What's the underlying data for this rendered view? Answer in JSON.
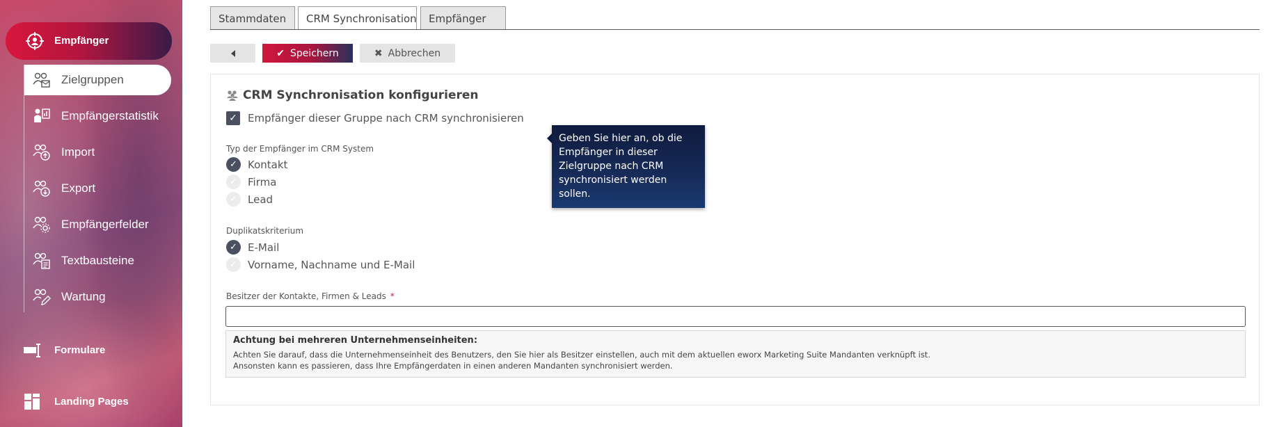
{
  "sidebar": {
    "main_item": {
      "label": "Empfänger",
      "icon": "recipient-target-icon"
    },
    "sub_items": [
      {
        "label": "Zielgruppen",
        "icon": "target-group-icon",
        "active": true
      },
      {
        "label": "Empfängerstatistik",
        "icon": "statistics-icon",
        "active": false
      },
      {
        "label": "Import",
        "icon": "import-icon",
        "active": false
      },
      {
        "label": "Export",
        "icon": "export-icon",
        "active": false
      },
      {
        "label": "Empfängerfelder",
        "icon": "fields-icon",
        "active": false
      },
      {
        "label": "Textbausteine",
        "icon": "text-blocks-icon",
        "active": false
      },
      {
        "label": "Wartung",
        "icon": "maintenance-icon",
        "active": false
      }
    ],
    "sections": [
      {
        "label": "Formulare",
        "icon": "forms-icon"
      },
      {
        "label": "Landing Pages",
        "icon": "landing-pages-icon"
      }
    ]
  },
  "tabs": [
    {
      "label": "Stammdaten",
      "active": false
    },
    {
      "label": "CRM Synchronisation",
      "active": true
    },
    {
      "label": "Empfänger",
      "active": false
    }
  ],
  "toolbar": {
    "back_icon": "caret-left-icon",
    "save_label": "Speichern",
    "cancel_label": "Abbrechen"
  },
  "panel": {
    "title": "CRM Synchronisation konfigurieren",
    "sync_checkbox_label": "Empfänger dieser Gruppe nach CRM synchronisieren",
    "sync_checked": true,
    "type_label": "Typ der Empfänger im CRM System",
    "type_options": [
      {
        "label": "Kontakt",
        "selected": true
      },
      {
        "label": "Firma",
        "selected": false
      },
      {
        "label": "Lead",
        "selected": false
      }
    ],
    "duplicate_label": "Duplikatskriterium",
    "duplicate_options": [
      {
        "label": "E-Mail",
        "selected": true
      },
      {
        "label": "Vorname, Nachname und E-Mail",
        "selected": false
      }
    ],
    "owner_label": "Besitzer der Kontakte, Firmen & Leads",
    "owner_required": "*",
    "owner_value": "",
    "note_title": "Achtung bei mehreren Unternehmenseinheiten:",
    "note_line1": "Achten Sie darauf, dass die Unternehmenseinheit des Benutzers, den Sie hier als Besitzer einstellen, auch mit dem aktuellen eworx Marketing Suite Mandanten verknüpft ist.",
    "note_line2": "Ansonsten kann es passieren, dass Ihre Empfängerdaten in einen anderen Mandanten synchronisiert werden."
  },
  "tooltip": {
    "text": "Geben Sie hier an, ob die Empfänger in dieser Zielgruppe nach CRM synchronisiert werden sollen."
  },
  "colors": {
    "accent_red": "#d0163c",
    "navy": "#172b59",
    "check_dark": "#4b5060"
  }
}
